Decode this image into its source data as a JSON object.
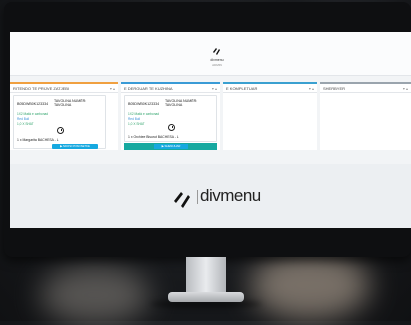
{
  "header": {
    "brand": "divmenu",
    "brand_sub": "ADMIN"
  },
  "columns": [
    {
      "title": "RITENDO TE PRIJVE ZATJEBI",
      "controls": "▾ ▴",
      "card": {
        "id": "B05DWB0K123334",
        "table": "TAVOLINA NUMËR: TAVOLINA",
        "items": [
          "1X2 Makk e carbonad",
          "Red Bull",
          "1,0 X SHAT"
        ],
        "user": "1 x Margarita BACHESA - L",
        "button": "▶ NDOSI POSOSETKE"
      }
    },
    {
      "title": "E DERGUAR TE KUZHINA",
      "controls": "▾ ▴",
      "card": {
        "id": "B05DWB0K123334",
        "table": "TAVOLINA NUMËR: TAVOLINA",
        "items": [
          "1X2 Makk e carbonad",
          "Red Bull",
          "1,0 X SHAT"
        ],
        "user": "1 x Orchiee Bisurut BACHESA - L",
        "button": "▶ SHENIJUAR"
      }
    },
    {
      "title": "E KOMPLETUAR",
      "controls": "▾ ▴"
    },
    {
      "title": "SHERBYER",
      "controls": "▾ ▴"
    }
  ],
  "footer_brand": "divmenu"
}
